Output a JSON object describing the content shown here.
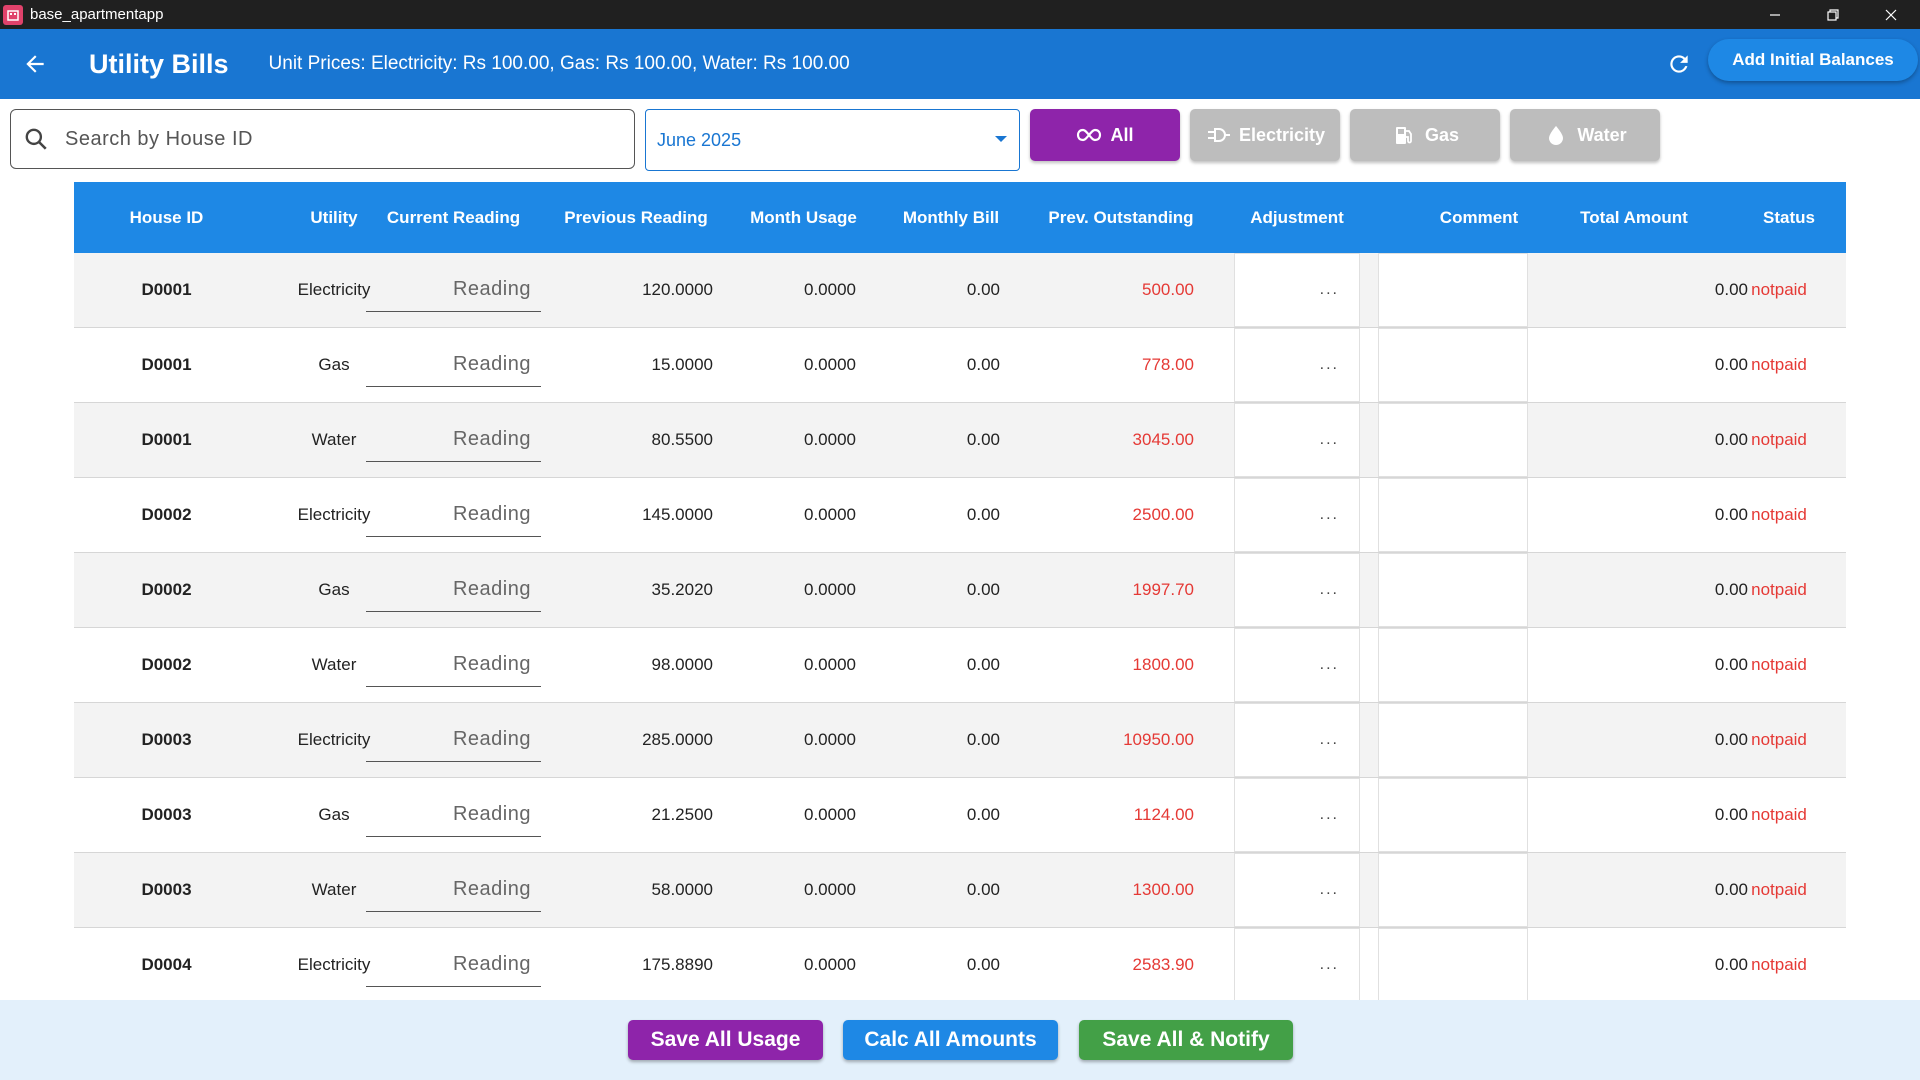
{
  "window": {
    "title": "base_apartmentapp"
  },
  "appbar": {
    "title": "Utility Bills",
    "unit_prices": "Unit Prices: Electricity: Rs 100.00, Gas: Rs 100.00, Water: Rs 100.00",
    "add_balances_label": "Add Initial Balances"
  },
  "filters": {
    "search_placeholder": "Search by House ID",
    "month": "June 2025",
    "all": "All",
    "electricity": "Electricity",
    "gas": "Gas",
    "water": "Water"
  },
  "table": {
    "headers": [
      "House ID",
      "Utility",
      "Current Reading",
      "Previous Reading",
      "Month Usage",
      "Monthly Bill",
      "Prev. Outstanding",
      "Adjustment",
      "Comment",
      "Total Amount",
      "Status"
    ],
    "reading_placeholder": "Reading",
    "adjustment_placeholder": "...",
    "rows": [
      {
        "house": "D0001",
        "utility": "Electricity",
        "prev": "120.0000",
        "usage": "0.0000",
        "bill": "0.00",
        "outstanding": "500.00",
        "total": "0.00",
        "status": "notpaid"
      },
      {
        "house": "D0001",
        "utility": "Gas",
        "prev": "15.0000",
        "usage": "0.0000",
        "bill": "0.00",
        "outstanding": "778.00",
        "total": "0.00",
        "status": "notpaid"
      },
      {
        "house": "D0001",
        "utility": "Water",
        "prev": "80.5500",
        "usage": "0.0000",
        "bill": "0.00",
        "outstanding": "3045.00",
        "total": "0.00",
        "status": "notpaid"
      },
      {
        "house": "D0002",
        "utility": "Electricity",
        "prev": "145.0000",
        "usage": "0.0000",
        "bill": "0.00",
        "outstanding": "2500.00",
        "total": "0.00",
        "status": "notpaid"
      },
      {
        "house": "D0002",
        "utility": "Gas",
        "prev": "35.2020",
        "usage": "0.0000",
        "bill": "0.00",
        "outstanding": "1997.70",
        "total": "0.00",
        "status": "notpaid"
      },
      {
        "house": "D0002",
        "utility": "Water",
        "prev": "98.0000",
        "usage": "0.0000",
        "bill": "0.00",
        "outstanding": "1800.00",
        "total": "0.00",
        "status": "notpaid"
      },
      {
        "house": "D0003",
        "utility": "Electricity",
        "prev": "285.0000",
        "usage": "0.0000",
        "bill": "0.00",
        "outstanding": "10950.00",
        "total": "0.00",
        "status": "notpaid"
      },
      {
        "house": "D0003",
        "utility": "Gas",
        "prev": "21.2500",
        "usage": "0.0000",
        "bill": "0.00",
        "outstanding": "1124.00",
        "total": "0.00",
        "status": "notpaid"
      },
      {
        "house": "D0003",
        "utility": "Water",
        "prev": "58.0000",
        "usage": "0.0000",
        "bill": "0.00",
        "outstanding": "1300.00",
        "total": "0.00",
        "status": "notpaid"
      },
      {
        "house": "D0004",
        "utility": "Electricity",
        "prev": "175.8890",
        "usage": "0.0000",
        "bill": "0.00",
        "outstanding": "2583.90",
        "total": "0.00",
        "status": "notpaid"
      }
    ]
  },
  "footer": {
    "save_usage": "Save All Usage",
    "calc_amounts": "Calc All Amounts",
    "save_notify": "Save All & Notify"
  },
  "colors": {
    "primary": "#1976d2",
    "accent_purple": "#8e24aa",
    "success_green": "#43a047",
    "danger_red": "#e53935",
    "inactive_gray": "#bdbdbd"
  }
}
